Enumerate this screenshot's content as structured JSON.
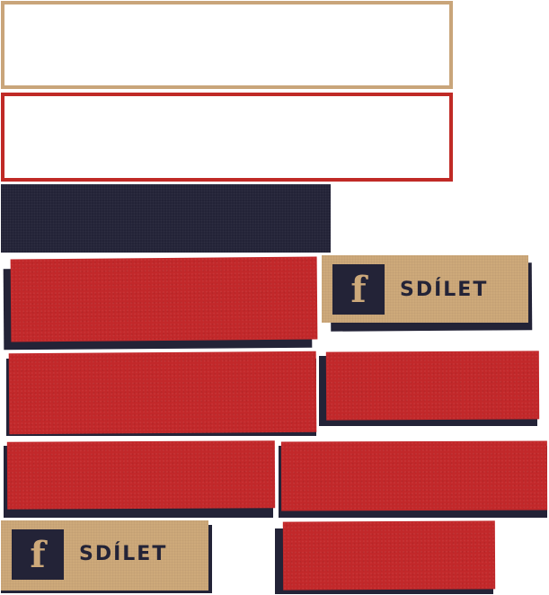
{
  "fields": [
    {
      "name": "tan-outlined-field",
      "border_color": "#c9a57a"
    },
    {
      "name": "red-outlined-field",
      "border_color": "#c02a26"
    }
  ],
  "share_buttons": [
    {
      "icon": "facebook-icon",
      "icon_glyph": "f",
      "label": "SDÍLET"
    },
    {
      "icon": "facebook-icon",
      "icon_glyph": "f",
      "label": "SDÍLET"
    }
  ],
  "colors": {
    "navy": "#232337",
    "red": "#c2282a",
    "tan": "#cda97a",
    "tan_border": "#c9a57a",
    "red_border": "#c02a26"
  }
}
